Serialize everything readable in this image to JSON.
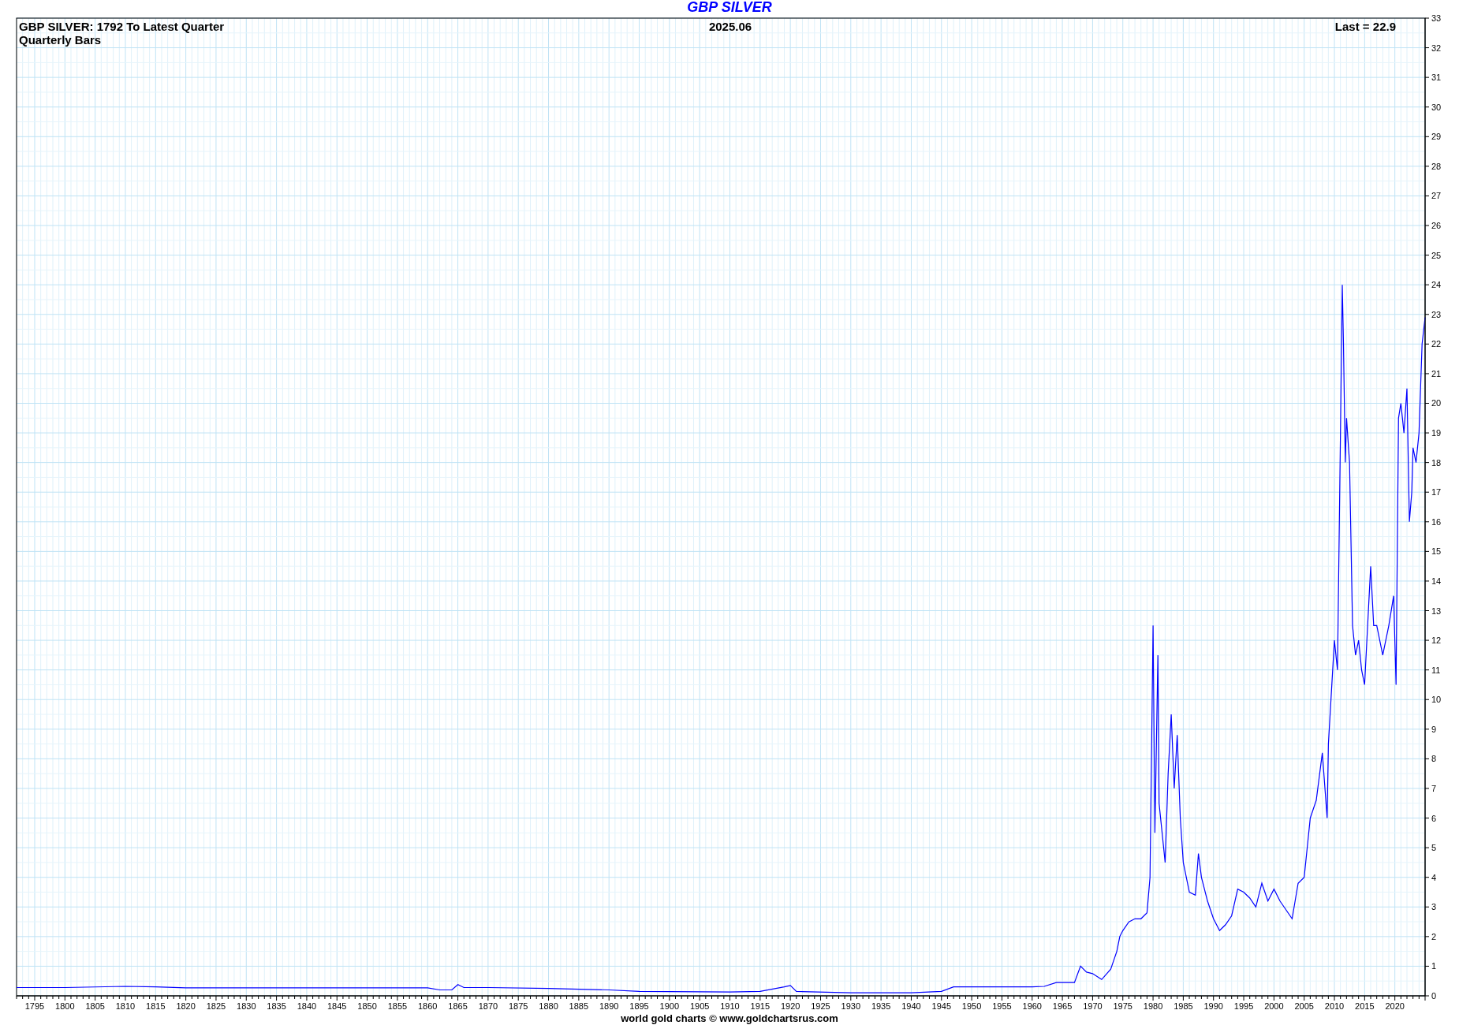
{
  "chart_title": "GBP SILVER",
  "chart": {
    "heading": "GBP SILVER: 1792 To Latest Quarter",
    "subheading": "Quarterly Bars",
    "date": "2025.06",
    "last": "Last = 22.9",
    "chart_data": {
      "type": "line",
      "x": [
        1792,
        1800,
        1810,
        1815,
        1820,
        1860,
        1862,
        1864,
        1865,
        1866,
        1870,
        1880,
        1890,
        1895,
        1910,
        1915,
        1919,
        1920,
        1921,
        1930,
        1935,
        1940,
        1945,
        1947,
        1950,
        1955,
        1960,
        1962,
        1964,
        1967,
        1968,
        1969,
        1970,
        1971.5,
        1973,
        1974,
        1974.5,
        1975,
        1976,
        1977,
        1978,
        1979,
        1979.5,
        1980,
        1980.3,
        1980.8,
        1981,
        1982,
        1982.5,
        1983,
        1983.5,
        1984,
        1984.5,
        1985,
        1986,
        1987,
        1987.5,
        1988,
        1989,
        1990,
        1991,
        1992,
        1993,
        1994,
        1995,
        1996,
        1997,
        1998,
        1999,
        2000,
        2001,
        2002,
        2003,
        2004,
        2005,
        2006,
        2007,
        2008,
        2008.8,
        2009,
        2010,
        2010.5,
        2011,
        2011.3,
        2011.5,
        2011.8,
        2012,
        2012.5,
        2013,
        2013.5,
        2014,
        2014.5,
        2015,
        2016,
        2016.5,
        2017,
        2018,
        2019,
        2019.8,
        2020.2,
        2020.6,
        2021,
        2021.5,
        2022,
        2022.4,
        2022.8,
        2023,
        2023.5,
        2024,
        2024.5,
        2025
      ],
      "series": [
        {
          "color": "#0000ff",
          "values": [
            0.28,
            0.28,
            0.32,
            0.3,
            0.27,
            0.27,
            0.2,
            0.2,
            0.38,
            0.28,
            0.28,
            0.25,
            0.2,
            0.15,
            0.13,
            0.15,
            0.3,
            0.35,
            0.15,
            0.1,
            0.1,
            0.1,
            0.15,
            0.3,
            0.3,
            0.3,
            0.3,
            0.32,
            0.45,
            0.45,
            1.0,
            0.8,
            0.75,
            0.55,
            0.9,
            1.5,
            2.0,
            2.2,
            2.5,
            2.6,
            2.6,
            2.8,
            4.0,
            12.5,
            5.5,
            11.5,
            6.5,
            4.5,
            7.5,
            9.5,
            7,
            8.8,
            6,
            4.5,
            3.5,
            3.4,
            4.8,
            4,
            3.2,
            2.6,
            2.2,
            2.4,
            2.7,
            3.6,
            3.5,
            3.3,
            3.0,
            3.8,
            3.2,
            3.6,
            3.2,
            2.9,
            2.6,
            3.8,
            4.0,
            6.0,
            6.6,
            8.2,
            6,
            8.5,
            12,
            11,
            19,
            24,
            22,
            18,
            19.5,
            18,
            12.5,
            11.5,
            12,
            11,
            10.5,
            14.5,
            12.5,
            12.5,
            11.5,
            12.5,
            13.5,
            10.5,
            19.5,
            20,
            19,
            20.5,
            16,
            17,
            18.5,
            18,
            19,
            22,
            22.9
          ]
        }
      ],
      "xlim": [
        1792,
        2025
      ],
      "ylim": [
        0,
        33
      ],
      "grid": true,
      "xticks": [
        1795,
        1800,
        1805,
        1810,
        1815,
        1820,
        1825,
        1830,
        1835,
        1840,
        1845,
        1850,
        1855,
        1860,
        1865,
        1870,
        1875,
        1880,
        1885,
        1890,
        1895,
        1900,
        1905,
        1910,
        1915,
        1920,
        1925,
        1930,
        1935,
        1940,
        1945,
        1950,
        1955,
        1960,
        1965,
        1970,
        1975,
        1980,
        1985,
        1990,
        1995,
        2000,
        2005,
        2010,
        2015,
        2020
      ],
      "yticks": [
        0,
        1,
        2,
        3,
        4,
        5,
        6,
        7,
        8,
        9,
        10,
        11,
        12,
        13,
        14,
        15,
        16,
        17,
        18,
        19,
        20,
        21,
        22,
        23,
        24,
        25,
        26,
        27,
        28,
        29,
        30,
        31,
        32,
        33
      ]
    }
  },
  "footer": "world gold charts © www.goldchartsrus.com"
}
